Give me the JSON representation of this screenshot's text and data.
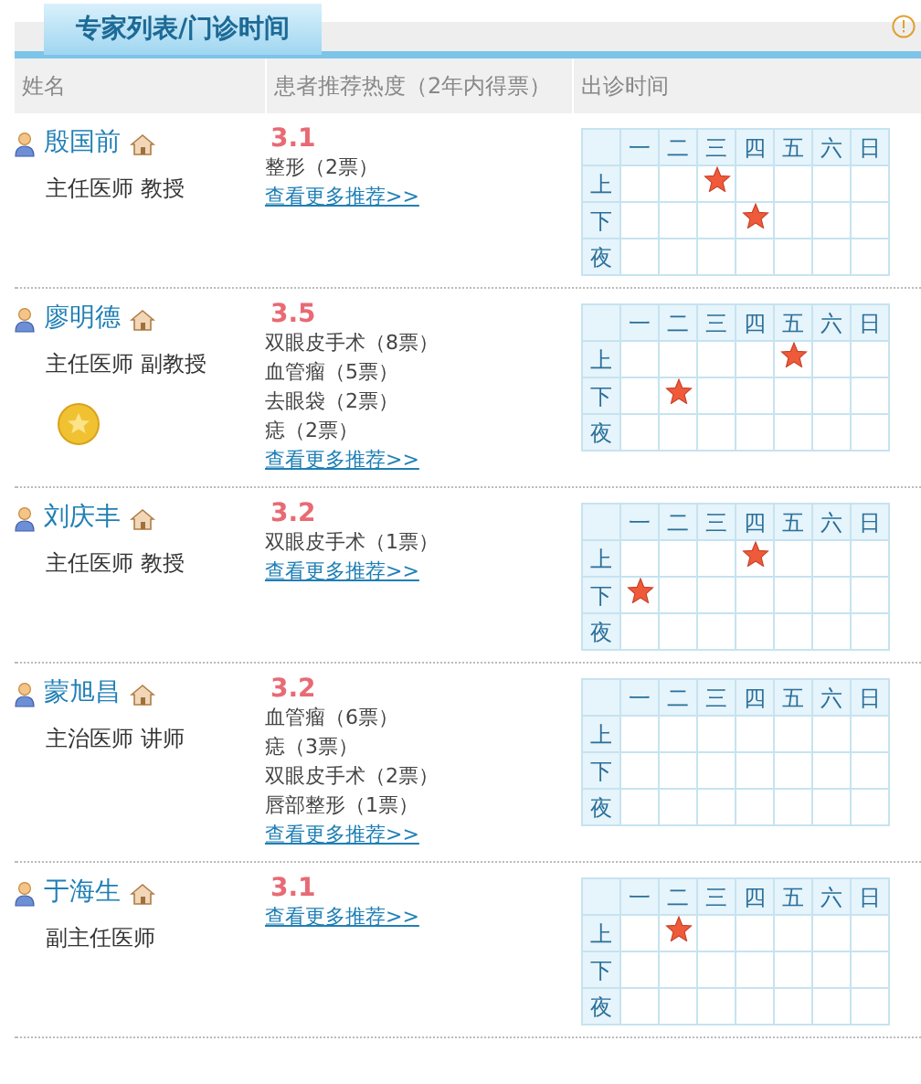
{
  "tab": {
    "label": "专家列表/门诊时间",
    "selected": true
  },
  "columns": [
    "姓名",
    "患者推荐热度（2年内得票）",
    "出诊时间"
  ],
  "doctors": [
    {
      "name": "殷国前",
      "title": "主任医师 教授",
      "medal": false,
      "score": "3.1",
      "votes": [
        "整形（2票）"
      ],
      "more": "查看更多推荐>>",
      "days": [
        "一",
        "二",
        "三",
        "四",
        "五",
        "六",
        "日"
      ],
      "schedule": [
        {
          "label": "上",
          "clinic": [
            false,
            false,
            true,
            false,
            false,
            false,
            false
          ]
        },
        {
          "label": "下",
          "clinic": [
            false,
            false,
            false,
            true,
            false,
            false,
            false
          ]
        },
        {
          "label": "夜",
          "clinic": [
            false,
            false,
            false,
            false,
            false,
            false,
            false
          ]
        }
      ]
    },
    {
      "name": "廖明德",
      "title": "主任医师 副教授",
      "medal": true,
      "score": "3.5",
      "votes": [
        "双眼皮手术（8票）",
        "血管瘤（5票）",
        "去眼袋（2票）",
        "痣（2票）"
      ],
      "more": "查看更多推荐>>",
      "days": [
        "一",
        "二",
        "三",
        "四",
        "五",
        "六",
        "日"
      ],
      "schedule": [
        {
          "label": "上",
          "clinic": [
            false,
            false,
            false,
            false,
            true,
            false,
            false
          ]
        },
        {
          "label": "下",
          "clinic": [
            false,
            true,
            false,
            false,
            false,
            false,
            false
          ]
        },
        {
          "label": "夜",
          "clinic": [
            false,
            false,
            false,
            false,
            false,
            false,
            false
          ]
        }
      ]
    },
    {
      "name": "刘庆丰",
      "title": "主任医师 教授",
      "medal": false,
      "score": "3.2",
      "votes": [
        "双眼皮手术（1票）"
      ],
      "more": "查看更多推荐>>",
      "days": [
        "一",
        "二",
        "三",
        "四",
        "五",
        "六",
        "日"
      ],
      "schedule": [
        {
          "label": "上",
          "clinic": [
            false,
            false,
            false,
            true,
            false,
            false,
            false
          ]
        },
        {
          "label": "下",
          "clinic": [
            true,
            false,
            false,
            false,
            false,
            false,
            false
          ]
        },
        {
          "label": "夜",
          "clinic": [
            false,
            false,
            false,
            false,
            false,
            false,
            false
          ]
        }
      ]
    },
    {
      "name": "蒙旭昌",
      "title": "主治医师 讲师",
      "medal": false,
      "score": "3.2",
      "votes": [
        "血管瘤（6票）",
        "痣（3票）",
        "双眼皮手术（2票）",
        "唇部整形（1票）"
      ],
      "more": "查看更多推荐>>",
      "days": [
        "一",
        "二",
        "三",
        "四",
        "五",
        "六",
        "日"
      ],
      "schedule": [
        {
          "label": "上",
          "clinic": [
            false,
            false,
            false,
            false,
            false,
            false,
            false
          ]
        },
        {
          "label": "下",
          "clinic": [
            false,
            false,
            false,
            false,
            false,
            false,
            false
          ]
        },
        {
          "label": "夜",
          "clinic": [
            false,
            false,
            false,
            false,
            false,
            false,
            false
          ]
        }
      ]
    },
    {
      "name": "于海生",
      "title": "副主任医师",
      "medal": false,
      "score": "3.1",
      "more": "查看更多推荐>>",
      "days": [
        "一",
        "二",
        "三",
        "四",
        "五",
        "六",
        "日"
      ],
      "schedule": [
        {
          "label": "上",
          "clinic": [
            false,
            true,
            false,
            false,
            false,
            false,
            false
          ]
        },
        {
          "label": "下",
          "clinic": [
            false,
            false,
            false,
            false,
            false,
            false,
            false
          ]
        },
        {
          "label": "夜",
          "clinic": [
            false,
            false,
            false,
            false,
            false,
            false,
            false
          ]
        }
      ]
    }
  ]
}
